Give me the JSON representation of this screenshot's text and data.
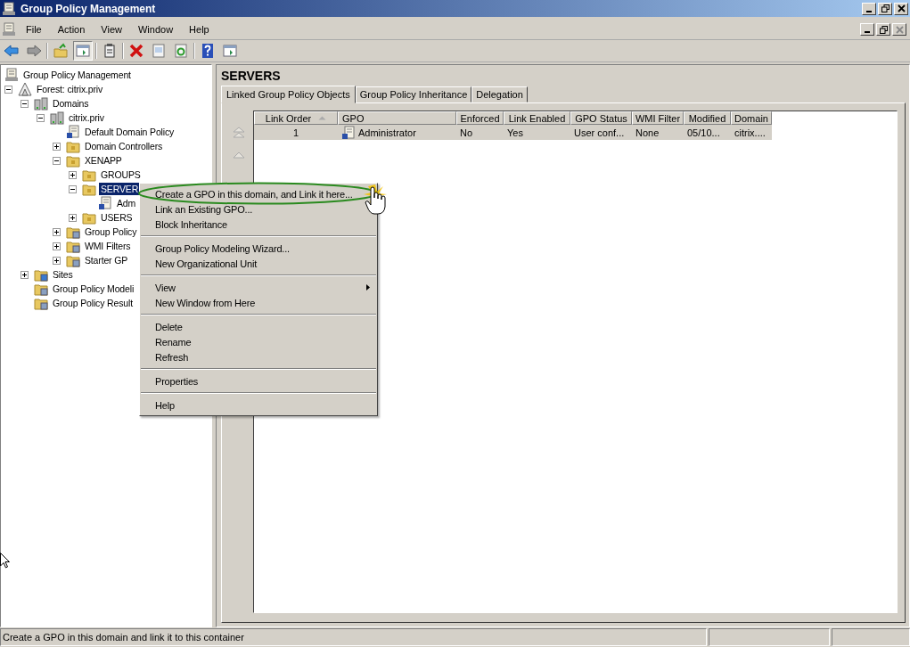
{
  "window": {
    "title": "Group Policy Management"
  },
  "menu_bar": [
    "File",
    "Action",
    "View",
    "Window",
    "Help"
  ],
  "toolbar": [
    {
      "kind": "back",
      "pressed": false
    },
    {
      "kind": "forward",
      "pressed": false
    },
    {
      "kind": "up",
      "pressed": false
    },
    {
      "kind": "tree",
      "pressed": true
    },
    {
      "kind": "clipboard",
      "pressed": false
    },
    {
      "kind": "delete",
      "pressed": false
    },
    {
      "kind": "properties",
      "pressed": false
    },
    {
      "kind": "refresh",
      "pressed": false
    },
    {
      "kind": "help",
      "pressed": false
    },
    {
      "kind": "pane",
      "pressed": false
    }
  ],
  "tree": {
    "label": "Group Policy Management",
    "kind": "console",
    "children": [
      {
        "label": "Forest: citrix.priv",
        "kind": "forest",
        "expanded": true,
        "selected": false,
        "children": [
          {
            "label": "Domains",
            "kind": "domains",
            "expanded": true,
            "selected": false,
            "children": [
              {
                "label": "citrix.priv",
                "kind": "domain",
                "expanded": true,
                "selected": false,
                "children": [
                  {
                    "label": "Default Domain Policy",
                    "kind": "gpo",
                    "selected": false
                  },
                  {
                    "label": "Domain Controllers",
                    "kind": "ou",
                    "expanded": false,
                    "selected": false
                  },
                  {
                    "label": "XENAPP",
                    "kind": "ou",
                    "expanded": true,
                    "selected": false,
                    "children": [
                      {
                        "label": "GROUPS",
                        "kind": "ou",
                        "expanded": false,
                        "selected": false
                      },
                      {
                        "label": "SERVER",
                        "kind": "ou",
                        "expanded": true,
                        "selected": true,
                        "children": [
                          {
                            "label": "Adm",
                            "kind": "gpo",
                            "selected": false
                          }
                        ]
                      },
                      {
                        "label": "USERS",
                        "kind": "ou",
                        "expanded": false,
                        "selected": false
                      }
                    ]
                  },
                  {
                    "label": "Group Policy",
                    "kind": "gpo-folder",
                    "expanded": false,
                    "selected": false
                  },
                  {
                    "label": "WMI Filters",
                    "kind": "wmi",
                    "expanded": false,
                    "selected": false
                  },
                  {
                    "label": "Starter GP",
                    "kind": "starter",
                    "expanded": false,
                    "selected": false
                  }
                ]
              }
            ]
          },
          {
            "label": "Sites",
            "kind": "sites",
            "expanded": false,
            "selected": false
          },
          {
            "label": "Group Policy Modeli",
            "kind": "modeling",
            "selected": false
          },
          {
            "label": "Group Policy Result",
            "kind": "results",
            "selected": false
          }
        ]
      }
    ]
  },
  "details": {
    "heading": "SERVERS",
    "tabs": [
      {
        "label": "Linked Group Policy Objects",
        "selected": true
      },
      {
        "label": "Group Policy Inheritance",
        "selected": false
      },
      {
        "label": "Delegation",
        "selected": false
      }
    ],
    "columns": [
      {
        "label": "Link Order",
        "sorted": true
      },
      {
        "label": "GPO",
        "sorted": false
      },
      {
        "label": "Enforced",
        "sorted": false
      },
      {
        "label": "Link Enabled",
        "sorted": false
      },
      {
        "label": "GPO Status",
        "sorted": false
      },
      {
        "label": "WMI Filter",
        "sorted": false
      },
      {
        "label": "Modified",
        "sorted": false
      },
      {
        "label": "Domain",
        "sorted": false
      }
    ],
    "rows": [
      {
        "selected": true,
        "cells": [
          "1",
          "Administrator",
          "No",
          "Yes",
          "User conf...",
          "None",
          "05/10...",
          "citrix...."
        ]
      }
    ]
  },
  "context_menu": [
    [
      {
        "label": "Create a GPO in this domain, and Link it here...",
        "submenu": false
      },
      {
        "label": "Link an Existing GPO...",
        "submenu": false
      },
      {
        "label": "Block Inheritance",
        "submenu": false
      }
    ],
    [
      {
        "label": "Group Policy Modeling Wizard...",
        "submenu": false
      },
      {
        "label": "New Organizational Unit",
        "submenu": false
      }
    ],
    [
      {
        "label": "View",
        "submenu": true
      },
      {
        "label": "New Window from Here",
        "submenu": false
      }
    ],
    [
      {
        "label": "Delete",
        "submenu": false
      },
      {
        "label": "Rename",
        "submenu": false
      },
      {
        "label": "Refresh",
        "submenu": false
      }
    ],
    [
      {
        "label": "Properties",
        "submenu": false
      }
    ],
    [
      {
        "label": "Help",
        "submenu": false
      }
    ]
  ],
  "status_bar": {
    "text": "Create a GPO in this domain and link it to this container"
  }
}
